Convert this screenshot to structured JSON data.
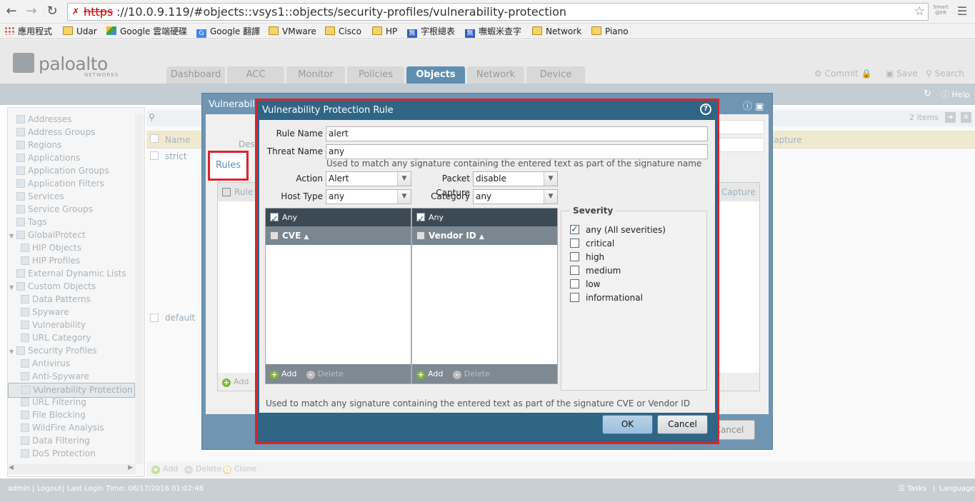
{
  "browser": {
    "url_protocol": "https",
    "url_rest": "://10.0.9.119/#objects::vsys1::objects/security-profiles/vulnerability-protection",
    "smart_label": "Smart",
    "bookmarks": [
      {
        "label": "應用程式",
        "icon": "apps-grid-icon"
      },
      {
        "label": "Udar",
        "icon": "folder-icon"
      },
      {
        "label": "Google 雲端硬碟",
        "icon": "google-drive-icon"
      },
      {
        "label": "Google 翻譯",
        "icon": "google-translate-icon"
      },
      {
        "label": "VMware",
        "icon": "folder-icon"
      },
      {
        "label": "Cisco",
        "icon": "folder-icon"
      },
      {
        "label": "HP",
        "icon": "folder-icon"
      },
      {
        "label": "字根總表",
        "icon": "bookmark-icon"
      },
      {
        "label": "嘸蝦米查字",
        "icon": "bookmark-icon"
      },
      {
        "label": "Network",
        "icon": "folder-icon"
      },
      {
        "label": "Piano",
        "icon": "folder-icon"
      }
    ]
  },
  "app": {
    "logo_text": "paloalto",
    "logo_sub": "NETWORKS",
    "tabs": [
      "Dashboard",
      "ACC",
      "Monitor",
      "Policies",
      "Objects",
      "Network",
      "Device"
    ],
    "active_tab": "Objects",
    "actions": {
      "commit": "Commit",
      "save": "Save",
      "search": "Search"
    },
    "help": "Help"
  },
  "tree": {
    "items": [
      {
        "label": "Addresses",
        "level": 0
      },
      {
        "label": "Address Groups",
        "level": 0
      },
      {
        "label": "Regions",
        "level": 0
      },
      {
        "label": "Applications",
        "level": 0
      },
      {
        "label": "Application Groups",
        "level": 0
      },
      {
        "label": "Application Filters",
        "level": 0
      },
      {
        "label": "Services",
        "level": 0
      },
      {
        "label": "Service Groups",
        "level": 0
      },
      {
        "label": "Tags",
        "level": 0
      },
      {
        "label": "GlobalProtect",
        "level": 0,
        "expander": true
      },
      {
        "label": "HIP Objects",
        "level": 1
      },
      {
        "label": "HIP Profiles",
        "level": 1
      },
      {
        "label": "External Dynamic Lists",
        "level": 0
      },
      {
        "label": "Custom Objects",
        "level": 0,
        "expander": true
      },
      {
        "label": "Data Patterns",
        "level": 1
      },
      {
        "label": "Spyware",
        "level": 1
      },
      {
        "label": "Vulnerability",
        "level": 1
      },
      {
        "label": "URL Category",
        "level": 1
      },
      {
        "label": "Security Profiles",
        "level": 0,
        "expander": true
      },
      {
        "label": "Antivirus",
        "level": 1
      },
      {
        "label": "Anti-Spyware",
        "level": 1
      },
      {
        "label": "Vulnerability Protection",
        "level": 1,
        "selected": true
      },
      {
        "label": "URL Filtering",
        "level": 1
      },
      {
        "label": "File Blocking",
        "level": 1
      },
      {
        "label": "WildFire Analysis",
        "level": 1
      },
      {
        "label": "Data Filtering",
        "level": 1
      },
      {
        "label": "DoS Protection",
        "level": 1
      }
    ]
  },
  "grid": {
    "items_count": "2 items",
    "col_name": "Name",
    "col_capture": "Capture",
    "rows": [
      "strict",
      "default"
    ],
    "bottom": {
      "add": "Add",
      "delete": "Delete",
      "clone": "Clone"
    }
  },
  "statusbar": {
    "user": "admin",
    "logout": "Logout",
    "last_login": "Last Login Time: 06/17/2016 01:02:48",
    "tasks": "Tasks",
    "language": "Language"
  },
  "bg_dialog": {
    "title": "Vulnerability",
    "desc_label": "Desc",
    "rules_tab": "Rules",
    "col_rule": "Rule",
    "col_capture": "Capture",
    "add": "Add",
    "cancel": "Cancel"
  },
  "dialog": {
    "title": "Vulnerability Protection Rule",
    "rule_name_label": "Rule Name",
    "rule_name_value": "alert",
    "threat_name_label": "Threat Name",
    "threat_name_value": "any",
    "threat_hint": "Used to match any signature containing the entered text as part of the signature name",
    "action_label": "Action",
    "action_value": "Alert",
    "packet_capture_label": "Packet Capture",
    "packet_capture_value": "disable",
    "host_type_label": "Host Type",
    "host_type_value": "any",
    "category_label": "Category",
    "category_value": "any",
    "cve_panel": {
      "any_label": "Any",
      "col": "CVE",
      "add": "Add",
      "delete": "Delete"
    },
    "vendor_panel": {
      "any_label": "Any",
      "col": "Vendor ID",
      "add": "Add",
      "delete": "Delete"
    },
    "severity": {
      "legend": "Severity",
      "options": [
        {
          "label": "any (All severities)",
          "checked": true
        },
        {
          "label": "critical",
          "checked": false
        },
        {
          "label": "high",
          "checked": false
        },
        {
          "label": "medium",
          "checked": false
        },
        {
          "label": "low",
          "checked": false
        },
        {
          "label": "informational",
          "checked": false
        }
      ]
    },
    "footer_hint": "Used to match any signature containing the entered text as part of the signature CVE or Vendor ID",
    "ok": "OK",
    "cancel": "Cancel"
  },
  "colors": {
    "accent": "#2f6585",
    "highlight": "#d7252f",
    "tab_active": "#5e8fb3"
  }
}
